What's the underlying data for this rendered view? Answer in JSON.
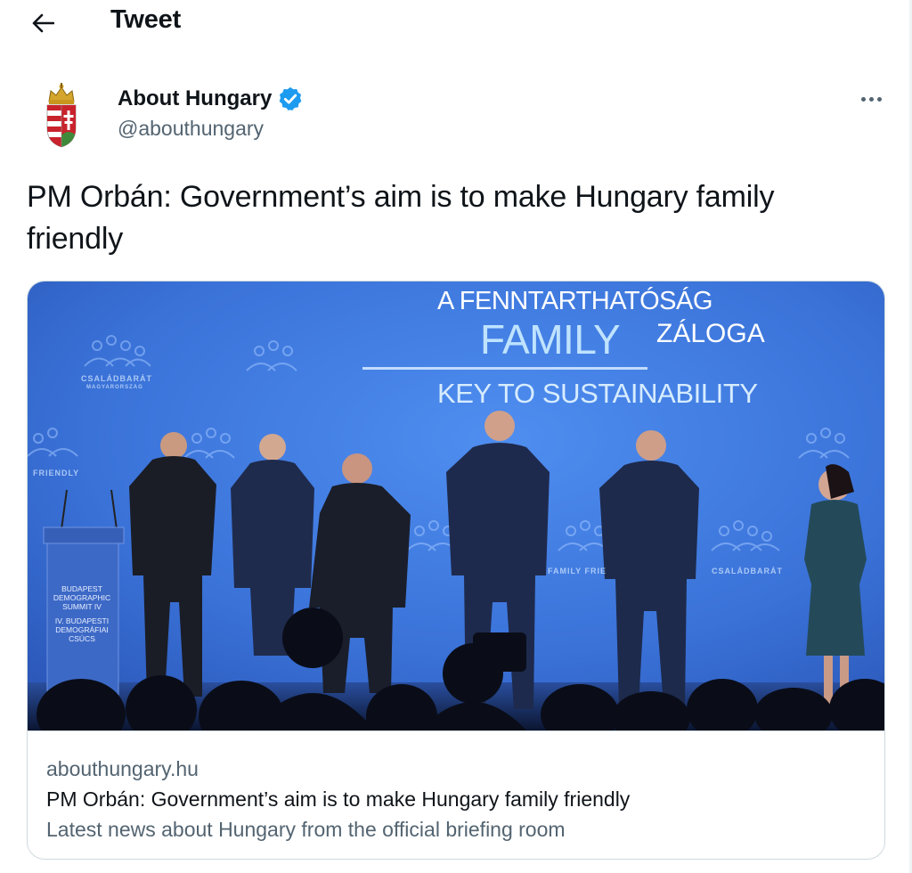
{
  "header": {
    "title": "Tweet",
    "back_icon": "arrow-left-icon"
  },
  "author": {
    "name": "About Hungary",
    "handle": "@abouthungary",
    "verified": true,
    "verified_color": "#1d9bf0"
  },
  "tweet": {
    "text": "PM Orbán: Government’s aim is to make Hungary family friendly"
  },
  "card": {
    "domain": "abouthungary.hu",
    "title": "PM Orbán: Government’s aim is to make Hungary family friendly",
    "description": "Latest news about Hungary from the official briefing room",
    "image": {
      "stage_line1": "A FENNTARTHATÓSÁG",
      "stage_line2_big": "FAMILY",
      "stage_line2_small": "ZÁLOGA",
      "stage_line3": "KEY TO SUSTAINABILITY",
      "logo_text_1": "CSALÁDBARÁT",
      "logo_text_1b": "MAGYARORSZÁG",
      "logo_text_2": "FRIENDLY",
      "logo_text_3": "CSALÁDBARÁT",
      "logo_text_4": "FAMILY FRIE",
      "podium_lines": [
        "BUDAPEST",
        "DEMOGRAPHIC",
        "SUMMIT IV",
        "IV. BUDAPESTI",
        "DEMOGRÁFIAI",
        "CSÚCS"
      ]
    }
  },
  "colors": {
    "text_primary": "#0f1419",
    "text_secondary": "#536471",
    "border": "#cfd9de",
    "backdrop_blue": "#3a6fd6"
  }
}
